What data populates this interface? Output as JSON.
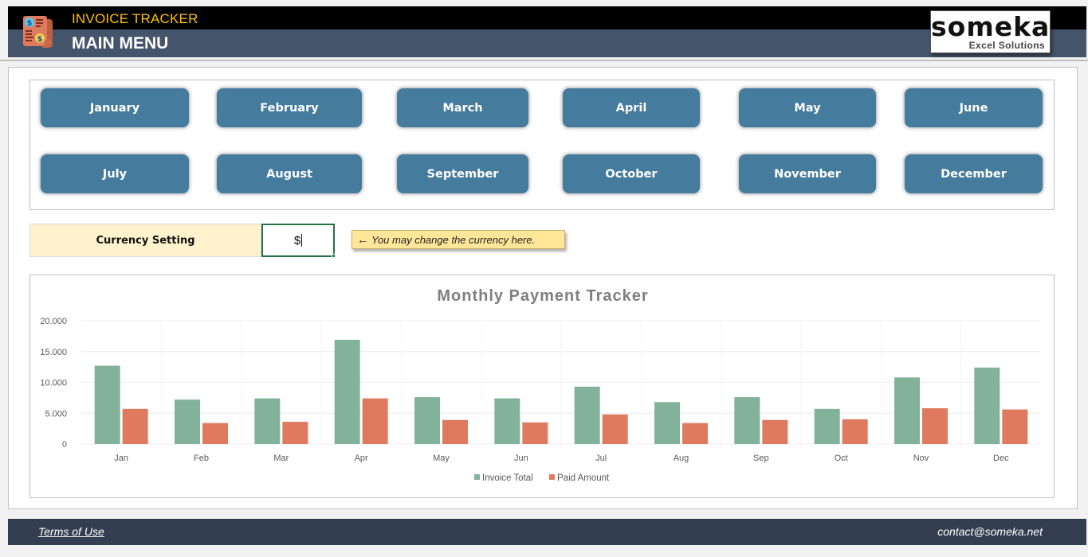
{
  "header": {
    "app_title": "INVOICE TRACKER",
    "page_title": "MAIN MENU",
    "logo_main": "someka",
    "logo_sub": "Excel Solutions",
    "app_icon": "invoice-receipt-icon"
  },
  "months": {
    "row1": [
      "January",
      "February",
      "March",
      "April",
      "May",
      "June"
    ],
    "row2": [
      "July",
      "August",
      "September",
      "October",
      "November",
      "December"
    ]
  },
  "currency": {
    "label": "Currency Setting",
    "value": "$",
    "hint": "You may change the currency here.",
    "hint_icon": "arrow-left-icon"
  },
  "colors": {
    "header_top": "#000000",
    "header_bottom": "#44546a",
    "app_title": "#ffc000",
    "month_button": "#457b9d",
    "currency_label_bg": "#fff2cc",
    "hint_bg": "#ffe699",
    "footer_bg": "#333f50",
    "invoice_series": "#82b29a",
    "paid_series": "#e07a5f"
  },
  "chart_data": {
    "type": "bar",
    "title": "Monthly Payment Tracker",
    "xlabel": "",
    "ylabel": "",
    "categories": [
      "Jan",
      "Feb",
      "Mar",
      "Apr",
      "May",
      "Jun",
      "Jul",
      "Aug",
      "Sep",
      "Oct",
      "Nov",
      "Dec"
    ],
    "series": [
      {
        "name": "Invoice Total",
        "color": "#82b29a",
        "values": [
          12700,
          7200,
          7400,
          16900,
          7600,
          7400,
          9300,
          6800,
          7600,
          5700,
          10800,
          12400
        ]
      },
      {
        "name": "Paid Amount",
        "color": "#e07a5f",
        "values": [
          5700,
          3400,
          3600,
          7400,
          3900,
          3500,
          4800,
          3400,
          3900,
          4000,
          5800,
          5600
        ]
      }
    ],
    "ylim": [
      0,
      20000
    ],
    "yticks": [
      0,
      5000,
      10000,
      15000,
      20000
    ],
    "ytick_labels": [
      "0",
      "5.000",
      "10.000",
      "15.000",
      "20.000"
    ],
    "grid": true,
    "legend": "bottom"
  },
  "footer": {
    "terms_label": "Terms of Use",
    "contact": "contact@someka.net"
  }
}
